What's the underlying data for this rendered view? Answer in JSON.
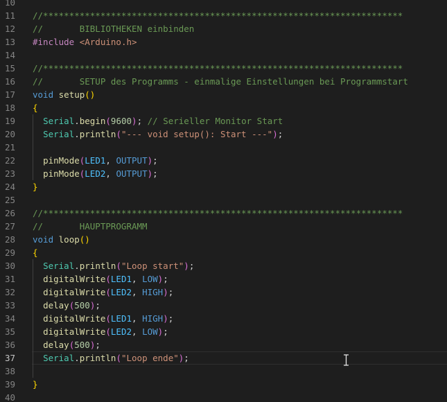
{
  "editor": {
    "active_line": 37,
    "lines": [
      {
        "num": "10",
        "tokens": []
      },
      {
        "num": "11",
        "tokens": [
          {
            "t": "//*********************************************************************",
            "c": "c"
          }
        ]
      },
      {
        "num": "12",
        "tokens": [
          {
            "t": "//       BIBLIOTHEKEN einbinden",
            "c": "c"
          }
        ]
      },
      {
        "num": "13",
        "tokens": [
          {
            "t": "#include ",
            "c": "p"
          },
          {
            "t": "<Arduino.h>",
            "c": "s"
          }
        ]
      },
      {
        "num": "14",
        "tokens": []
      },
      {
        "num": "15",
        "tokens": [
          {
            "t": "//*********************************************************************",
            "c": "c"
          }
        ]
      },
      {
        "num": "16",
        "tokens": [
          {
            "t": "//       SETUP des Programms - einmalige Einstellungen bei Programmstart",
            "c": "c"
          }
        ]
      },
      {
        "num": "17",
        "tokens": [
          {
            "t": "void",
            "c": "k"
          },
          {
            "t": " ",
            "c": "d"
          },
          {
            "t": "setup",
            "c": "f"
          },
          {
            "t": "()",
            "c": "b1"
          }
        ]
      },
      {
        "num": "18",
        "tokens": [
          {
            "t": "{",
            "c": "b1"
          }
        ]
      },
      {
        "num": "19",
        "tokens": [
          {
            "t": "  ",
            "c": "d"
          },
          {
            "t": "Serial",
            "c": "t"
          },
          {
            "t": ".",
            "c": "d"
          },
          {
            "t": "begin",
            "c": "f"
          },
          {
            "t": "(",
            "c": "b2"
          },
          {
            "t": "9600",
            "c": "n"
          },
          {
            "t": ")",
            "c": "b2"
          },
          {
            "t": "; ",
            "c": "d"
          },
          {
            "t": "// Serieller Monitor Start",
            "c": "c"
          }
        ]
      },
      {
        "num": "20",
        "tokens": [
          {
            "t": "  ",
            "c": "d"
          },
          {
            "t": "Serial",
            "c": "t"
          },
          {
            "t": ".",
            "c": "d"
          },
          {
            "t": "println",
            "c": "f"
          },
          {
            "t": "(",
            "c": "b2"
          },
          {
            "t": "\"--- void setup(): Start ---\"",
            "c": "s"
          },
          {
            "t": ")",
            "c": "b2"
          },
          {
            "t": ";",
            "c": "d"
          }
        ]
      },
      {
        "num": "21",
        "tokens": []
      },
      {
        "num": "22",
        "tokens": [
          {
            "t": "  ",
            "c": "d"
          },
          {
            "t": "pinMode",
            "c": "f"
          },
          {
            "t": "(",
            "c": "b2"
          },
          {
            "t": "LED1",
            "c": "cs"
          },
          {
            "t": ", ",
            "c": "d"
          },
          {
            "t": "OUTPUT",
            "c": "k"
          },
          {
            "t": ")",
            "c": "b2"
          },
          {
            "t": ";",
            "c": "d"
          }
        ]
      },
      {
        "num": "23",
        "tokens": [
          {
            "t": "  ",
            "c": "d"
          },
          {
            "t": "pinMode",
            "c": "f"
          },
          {
            "t": "(",
            "c": "b2"
          },
          {
            "t": "LED2",
            "c": "cs"
          },
          {
            "t": ", ",
            "c": "d"
          },
          {
            "t": "OUTPUT",
            "c": "k"
          },
          {
            "t": ")",
            "c": "b2"
          },
          {
            "t": ";",
            "c": "d"
          }
        ]
      },
      {
        "num": "24",
        "tokens": [
          {
            "t": "}",
            "c": "b1"
          }
        ]
      },
      {
        "num": "25",
        "tokens": []
      },
      {
        "num": "26",
        "tokens": [
          {
            "t": "//*********************************************************************",
            "c": "c"
          }
        ]
      },
      {
        "num": "27",
        "tokens": [
          {
            "t": "//       HAUPTPROGRAMM",
            "c": "c"
          }
        ]
      },
      {
        "num": "28",
        "tokens": [
          {
            "t": "void",
            "c": "k"
          },
          {
            "t": " ",
            "c": "d"
          },
          {
            "t": "loop",
            "c": "f"
          },
          {
            "t": "()",
            "c": "b1"
          }
        ]
      },
      {
        "num": "29",
        "tokens": [
          {
            "t": "{",
            "c": "b1"
          }
        ]
      },
      {
        "num": "30",
        "tokens": [
          {
            "t": "  ",
            "c": "d"
          },
          {
            "t": "Serial",
            "c": "t"
          },
          {
            "t": ".",
            "c": "d"
          },
          {
            "t": "println",
            "c": "f"
          },
          {
            "t": "(",
            "c": "b2"
          },
          {
            "t": "\"Loop start\"",
            "c": "s"
          },
          {
            "t": ")",
            "c": "b2"
          },
          {
            "t": ";",
            "c": "d"
          }
        ]
      },
      {
        "num": "31",
        "tokens": [
          {
            "t": "  ",
            "c": "d"
          },
          {
            "t": "digitalWrite",
            "c": "f"
          },
          {
            "t": "(",
            "c": "b2"
          },
          {
            "t": "LED1",
            "c": "cs"
          },
          {
            "t": ", ",
            "c": "d"
          },
          {
            "t": "LOW",
            "c": "k"
          },
          {
            "t": ")",
            "c": "b2"
          },
          {
            "t": ";",
            "c": "d"
          }
        ]
      },
      {
        "num": "32",
        "tokens": [
          {
            "t": "  ",
            "c": "d"
          },
          {
            "t": "digitalWrite",
            "c": "f"
          },
          {
            "t": "(",
            "c": "b2"
          },
          {
            "t": "LED2",
            "c": "cs"
          },
          {
            "t": ", ",
            "c": "d"
          },
          {
            "t": "HIGH",
            "c": "k"
          },
          {
            "t": ")",
            "c": "b2"
          },
          {
            "t": ";",
            "c": "d"
          }
        ]
      },
      {
        "num": "33",
        "tokens": [
          {
            "t": "  ",
            "c": "d"
          },
          {
            "t": "delay",
            "c": "f"
          },
          {
            "t": "(",
            "c": "b2"
          },
          {
            "t": "500",
            "c": "n"
          },
          {
            "t": ")",
            "c": "b2"
          },
          {
            "t": ";",
            "c": "d"
          }
        ]
      },
      {
        "num": "34",
        "tokens": [
          {
            "t": "  ",
            "c": "d"
          },
          {
            "t": "digitalWrite",
            "c": "f"
          },
          {
            "t": "(",
            "c": "b2"
          },
          {
            "t": "LED1",
            "c": "cs"
          },
          {
            "t": ", ",
            "c": "d"
          },
          {
            "t": "HIGH",
            "c": "k"
          },
          {
            "t": ")",
            "c": "b2"
          },
          {
            "t": ";",
            "c": "d"
          }
        ]
      },
      {
        "num": "35",
        "tokens": [
          {
            "t": "  ",
            "c": "d"
          },
          {
            "t": "digitalWrite",
            "c": "f"
          },
          {
            "t": "(",
            "c": "b2"
          },
          {
            "t": "LED2",
            "c": "cs"
          },
          {
            "t": ", ",
            "c": "d"
          },
          {
            "t": "LOW",
            "c": "k"
          },
          {
            "t": ")",
            "c": "b2"
          },
          {
            "t": ";",
            "c": "d"
          }
        ]
      },
      {
        "num": "36",
        "tokens": [
          {
            "t": "  ",
            "c": "d"
          },
          {
            "t": "delay",
            "c": "f"
          },
          {
            "t": "(",
            "c": "b2"
          },
          {
            "t": "500",
            "c": "n"
          },
          {
            "t": ")",
            "c": "b2"
          },
          {
            "t": ";",
            "c": "d"
          }
        ]
      },
      {
        "num": "37",
        "tokens": [
          {
            "t": "  ",
            "c": "d"
          },
          {
            "t": "Serial",
            "c": "t"
          },
          {
            "t": ".",
            "c": "d"
          },
          {
            "t": "println",
            "c": "f"
          },
          {
            "t": "(",
            "c": "b2"
          },
          {
            "t": "\"Loop ende\"",
            "c": "s"
          },
          {
            "t": ")",
            "c": "b2"
          },
          {
            "t": ";",
            "c": "d"
          }
        ]
      },
      {
        "num": "38",
        "tokens": []
      },
      {
        "num": "39",
        "tokens": [
          {
            "t": "}",
            "c": "b1"
          }
        ]
      },
      {
        "num": "40",
        "tokens": []
      }
    ]
  },
  "cursor": {
    "icon": "text-cursor-ibeam-icon"
  }
}
